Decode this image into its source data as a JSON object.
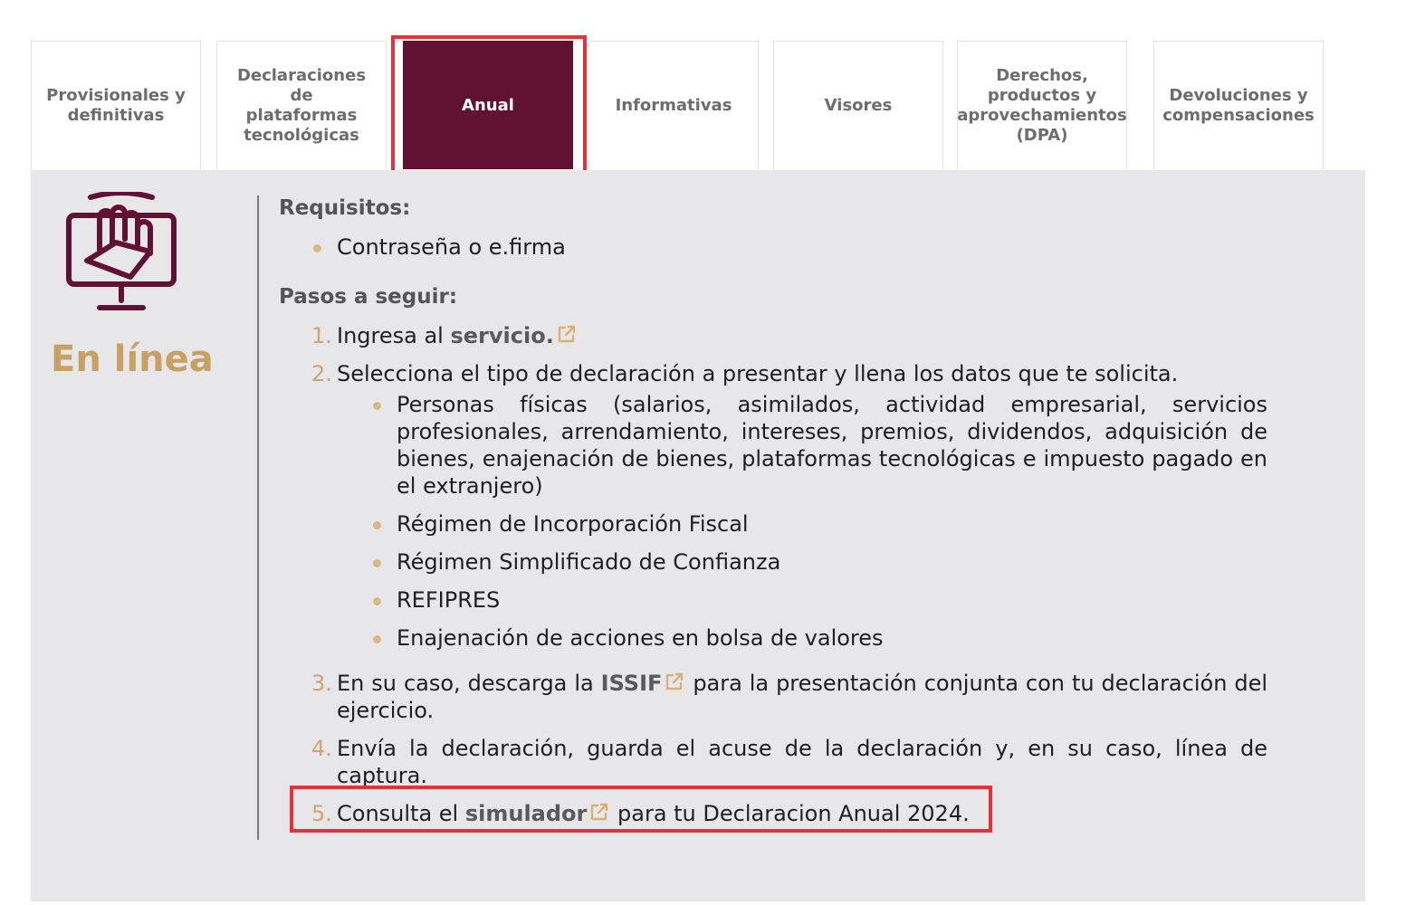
{
  "tabs": [
    {
      "label": "Provisionales y\ndefinitivas",
      "active": false
    },
    {
      "label": "Declaraciones de\nplataformas\ntecnológicas",
      "active": false
    },
    {
      "label": "Anual",
      "active": true
    },
    {
      "label": "Informativas",
      "active": false
    },
    {
      "label": "Visores",
      "active": false
    },
    {
      "label": "Derechos,\nproductos y\naprovechamientos\n(DPA)",
      "active": false
    },
    {
      "label": "Devoluciones y\ncompensaciones",
      "active": false
    }
  ],
  "sidebar": {
    "icon": "monitor-hand-icon",
    "title": "En línea"
  },
  "requirements": {
    "heading": "Requisitos:",
    "items": [
      "Contraseña o e.firma"
    ]
  },
  "steps": {
    "heading": "Pasos a seguir:",
    "step1": {
      "number": "1.",
      "text": "Ingresa al ",
      "link": "servicio."
    },
    "step2": {
      "number": "2.",
      "text": "Selecciona el tipo de declaración a presentar y llena los datos que te solicita.",
      "sub_items": [
        "Personas físicas (salarios, asimilados, actividad empresarial, servicios profesionales, arrendamiento, intereses, premios, dividendos, adquisición de bienes, enajenación de bienes, plataformas tecnológicas e impuesto pagado en el extranjero)",
        "Régimen de Incorporación Fiscal",
        "Régimen Simplificado de Confianza",
        "REFIPRES",
        "Enajenación de acciones en bolsa de valores"
      ]
    },
    "step3": {
      "number": "3.",
      "text_before": "En su caso, descarga la ",
      "link": "ISSIF",
      "text_after": " para la presentación conjunta con tu declaración del ejercicio."
    },
    "step4": {
      "number": "4.",
      "text": "Envía la declaración, guarda el acuse de la declaración y, en su caso, línea de captura."
    },
    "step5": {
      "number": "5.",
      "text_before": "Consulta el ",
      "link": "simulador",
      "text_after": " para tu Declaracion Anual 2024."
    }
  },
  "colors": {
    "active_tab": "#611232",
    "accent_gold": "#c8a063",
    "highlight_red": "#e53238",
    "panel_bg": "#e7e6e8"
  }
}
